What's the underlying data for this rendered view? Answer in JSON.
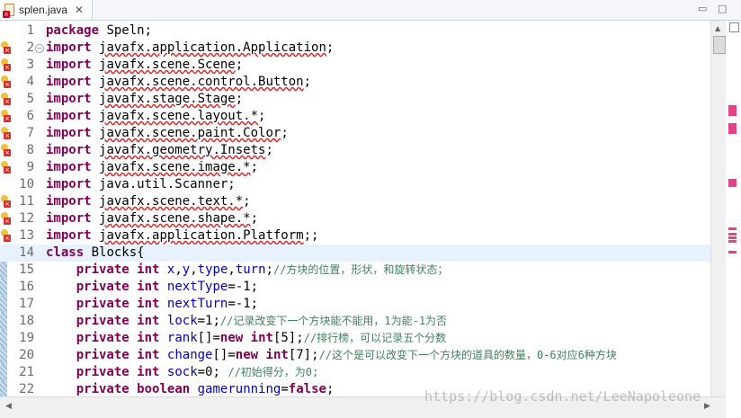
{
  "tab": {
    "filename": "splen.java",
    "close_glyph": "✕",
    "minimize_glyph": "▭",
    "maximize_glyph": "□"
  },
  "lines": [
    {
      "num": "1",
      "marker": false,
      "fold": false,
      "parts": [
        [
          "kw",
          "package"
        ],
        [
          "t",
          " Speln;"
        ]
      ]
    },
    {
      "num": "2",
      "marker": true,
      "fold": true,
      "parts": [
        [
          "kw",
          "import"
        ],
        [
          "t",
          " "
        ],
        [
          "e",
          "javafx.application.Application"
        ],
        [
          "t",
          ";"
        ]
      ]
    },
    {
      "num": "3",
      "marker": true,
      "fold": false,
      "parts": [
        [
          "kw",
          "import"
        ],
        [
          "t",
          " "
        ],
        [
          "e",
          "javafx.scene.Scene"
        ],
        [
          "t",
          ";"
        ]
      ]
    },
    {
      "num": "4",
      "marker": true,
      "fold": false,
      "parts": [
        [
          "kw",
          "import"
        ],
        [
          "t",
          " "
        ],
        [
          "e",
          "javafx.scene.control.Button"
        ],
        [
          "t",
          ";"
        ]
      ]
    },
    {
      "num": "5",
      "marker": true,
      "fold": false,
      "parts": [
        [
          "kw",
          "import"
        ],
        [
          "t",
          " "
        ],
        [
          "e",
          "javafx.stage.Stage"
        ],
        [
          "t",
          ";"
        ]
      ]
    },
    {
      "num": "6",
      "marker": true,
      "fold": false,
      "parts": [
        [
          "kw",
          "import"
        ],
        [
          "t",
          " "
        ],
        [
          "e",
          "javafx.scene.layout.*"
        ],
        [
          "t",
          ";"
        ]
      ]
    },
    {
      "num": "7",
      "marker": true,
      "fold": false,
      "parts": [
        [
          "kw",
          "import"
        ],
        [
          "t",
          " "
        ],
        [
          "e",
          "javafx.scene.paint.Color"
        ],
        [
          "t",
          ";"
        ]
      ]
    },
    {
      "num": "8",
      "marker": true,
      "fold": false,
      "parts": [
        [
          "kw",
          "import"
        ],
        [
          "t",
          " "
        ],
        [
          "e",
          "javafx.geometry.Insets"
        ],
        [
          "t",
          ";"
        ]
      ]
    },
    {
      "num": "9",
      "marker": true,
      "fold": false,
      "parts": [
        [
          "kw",
          "import"
        ],
        [
          "t",
          " "
        ],
        [
          "e",
          "javafx.scene.image.*"
        ],
        [
          "t",
          ";"
        ]
      ]
    },
    {
      "num": "10",
      "marker": false,
      "fold": false,
      "parts": [
        [
          "kw",
          "import"
        ],
        [
          "t",
          " java.util.Scanner;"
        ]
      ]
    },
    {
      "num": "11",
      "marker": true,
      "fold": false,
      "parts": [
        [
          "kw",
          "import"
        ],
        [
          "t",
          " "
        ],
        [
          "e",
          "javafx.scene.text.*"
        ],
        [
          "t",
          ";"
        ]
      ]
    },
    {
      "num": "12",
      "marker": true,
      "fold": false,
      "parts": [
        [
          "kw",
          "import"
        ],
        [
          "t",
          " "
        ],
        [
          "e",
          "javafx.scene.shape.*"
        ],
        [
          "t",
          ";"
        ]
      ]
    },
    {
      "num": "13",
      "marker": true,
      "fold": false,
      "parts": [
        [
          "kw",
          "import"
        ],
        [
          "t",
          " "
        ],
        [
          "e",
          "javafx.application.Platform"
        ],
        [
          "t",
          ";;"
        ]
      ]
    },
    {
      "num": "14",
      "marker": false,
      "fold": false,
      "current": true,
      "parts": [
        [
          "kw",
          "class"
        ],
        [
          "t",
          " Blocks{"
        ]
      ]
    },
    {
      "num": "15",
      "marker": false,
      "fold": false,
      "changed": true,
      "parts": [
        [
          "t",
          "    "
        ],
        [
          "kw",
          "private"
        ],
        [
          "t",
          " "
        ],
        [
          "kw",
          "int"
        ],
        [
          "t",
          " "
        ],
        [
          "fld",
          "x"
        ],
        [
          "t",
          ","
        ],
        [
          "fld",
          "y"
        ],
        [
          "t",
          ","
        ],
        [
          "fld",
          "type"
        ],
        [
          "t",
          ","
        ],
        [
          "fld",
          "turn"
        ],
        [
          "t",
          ";"
        ],
        [
          "cm",
          "//方块的位置，形状，和旋转状态；"
        ]
      ]
    },
    {
      "num": "16",
      "marker": false,
      "fold": false,
      "changed": true,
      "parts": [
        [
          "t",
          "    "
        ],
        [
          "kw",
          "private"
        ],
        [
          "t",
          " "
        ],
        [
          "kw",
          "int"
        ],
        [
          "t",
          " "
        ],
        [
          "fld",
          "nextType"
        ],
        [
          "t",
          "=-1;"
        ]
      ]
    },
    {
      "num": "17",
      "marker": false,
      "fold": false,
      "changed": true,
      "parts": [
        [
          "t",
          "    "
        ],
        [
          "kw",
          "private"
        ],
        [
          "t",
          " "
        ],
        [
          "kw",
          "int"
        ],
        [
          "t",
          " "
        ],
        [
          "fld",
          "nextTurn"
        ],
        [
          "t",
          "=-1;"
        ]
      ]
    },
    {
      "num": "18",
      "marker": false,
      "fold": false,
      "changed": true,
      "parts": [
        [
          "t",
          "    "
        ],
        [
          "kw",
          "private"
        ],
        [
          "t",
          " "
        ],
        [
          "kw",
          "int"
        ],
        [
          "t",
          " "
        ],
        [
          "fld",
          "lock"
        ],
        [
          "t",
          "=1;"
        ],
        [
          "cm",
          "//记录改变下一个方块能不能用，1为能-1为否"
        ]
      ]
    },
    {
      "num": "19",
      "marker": false,
      "fold": false,
      "changed": true,
      "parts": [
        [
          "t",
          "    "
        ],
        [
          "kw",
          "private"
        ],
        [
          "t",
          " "
        ],
        [
          "kw",
          "int"
        ],
        [
          "t",
          " "
        ],
        [
          "fld",
          "rank"
        ],
        [
          "t",
          "[]="
        ],
        [
          "kw",
          "new"
        ],
        [
          "t",
          " "
        ],
        [
          "kw",
          "int"
        ],
        [
          "t",
          "[5];"
        ],
        [
          "cm",
          "//排行榜，可以记录五个分数"
        ]
      ]
    },
    {
      "num": "20",
      "marker": false,
      "fold": false,
      "changed": true,
      "parts": [
        [
          "t",
          "    "
        ],
        [
          "kw",
          "private"
        ],
        [
          "t",
          " "
        ],
        [
          "kw",
          "int"
        ],
        [
          "t",
          " "
        ],
        [
          "fld",
          "change"
        ],
        [
          "t",
          "[]="
        ],
        [
          "kw",
          "new"
        ],
        [
          "t",
          " "
        ],
        [
          "kw",
          "int"
        ],
        [
          "t",
          "[7];"
        ],
        [
          "cm",
          "//这个是可以改变下一个方块的道具的数量，0-6对应6种方块"
        ]
      ]
    },
    {
      "num": "21",
      "marker": false,
      "fold": false,
      "changed": true,
      "parts": [
        [
          "t",
          "    "
        ],
        [
          "kw",
          "private"
        ],
        [
          "t",
          " "
        ],
        [
          "kw",
          "int"
        ],
        [
          "t",
          " "
        ],
        [
          "fld",
          "sock"
        ],
        [
          "t",
          "=0; "
        ],
        [
          "cm",
          "//初始得分，为0;"
        ]
      ]
    },
    {
      "num": "22",
      "marker": false,
      "fold": false,
      "changed": true,
      "parts": [
        [
          "t",
          "    "
        ],
        [
          "kw",
          "private"
        ],
        [
          "t",
          " "
        ],
        [
          "kw",
          "boolean"
        ],
        [
          "t",
          " "
        ],
        [
          "fld",
          "gamerunning"
        ],
        [
          "t",
          "="
        ],
        [
          "kw",
          "false"
        ],
        [
          "t",
          ";"
        ]
      ]
    }
  ],
  "watermark": "https://blog.csdn.net/LeeNapoleone",
  "colors": {
    "keyword": "#7f0055",
    "field": "#0000c0",
    "comment": "#3f7f5f",
    "error_underline": "#e02020",
    "overview_mark": "#e6428a"
  }
}
